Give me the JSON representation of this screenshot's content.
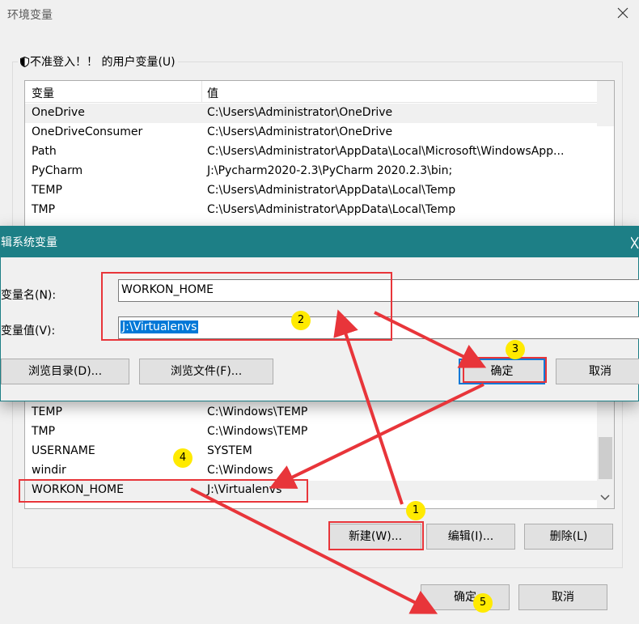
{
  "window": {
    "title": "环境变量"
  },
  "user_vars": {
    "legend": "不准登入！！ 的用户变量(U)",
    "columns": [
      "变量",
      "值"
    ],
    "rows": [
      {
        "name": "OneDrive",
        "value": "C:\\Users\\Administrator\\OneDrive"
      },
      {
        "name": "OneDriveConsumer",
        "value": "C:\\Users\\Administrator\\OneDrive"
      },
      {
        "name": "Path",
        "value": "C:\\Users\\Administrator\\AppData\\Local\\Microsoft\\WindowsApp..."
      },
      {
        "name": "PyCharm",
        "value": "J:\\Pycharm2020-2.3\\PyCharm 2020.2.3\\bin;"
      },
      {
        "name": "TEMP",
        "value": "C:\\Users\\Administrator\\AppData\\Local\\Temp"
      },
      {
        "name": "TMP",
        "value": "C:\\Users\\Administrator\\AppData\\Local\\Temp"
      }
    ]
  },
  "system_vars": {
    "rows": [
      {
        "name": "TEMP",
        "value": "C:\\Windows\\TEMP"
      },
      {
        "name": "TMP",
        "value": "C:\\Windows\\TEMP"
      },
      {
        "name": "USERNAME",
        "value": "SYSTEM"
      },
      {
        "name": "windir",
        "value": "C:\\Windows"
      },
      {
        "name": "WORKON_HOME",
        "value": "J:\\Virtualenvs"
      }
    ],
    "buttons": {
      "new": "新建(W)...",
      "edit": "编辑(I)...",
      "delete": "删除(L)"
    }
  },
  "edit_dialog": {
    "title": "辑系统变量",
    "name_label": "变量名(N):",
    "value_label": "变量值(V):",
    "name_value": "WORKON_HOME",
    "value_value": "J:\\Virtualenvs",
    "buttons": {
      "browse_dir": "浏览目录(D)...",
      "browse_file": "浏览文件(F)...",
      "ok": "确定",
      "cancel": "取消"
    }
  },
  "footer": {
    "ok": "确定",
    "cancel": "取消"
  },
  "annotations": {
    "badges": [
      "1",
      "2",
      "3",
      "4",
      "5"
    ],
    "color": "#e8353a",
    "badge_color": "#ffea00"
  },
  "colors": {
    "dialog_title": "#1d7f86",
    "selection": "#0078d7"
  }
}
